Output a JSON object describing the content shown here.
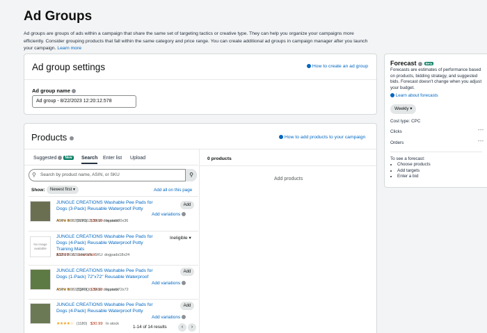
{
  "page": {
    "title": "Ad Groups",
    "intro": "Ad groups are groups of ads within a campaign that share the same set of targeting tactics or creative type. They can help you organize your campaigns more efficiently. Consider grouping products that fall within the same category and price range. You can create additional ad groups in campaign manager after you launch your campaign.",
    "learn_more": "Learn more"
  },
  "settings": {
    "heading": "Ad group settings",
    "help_link": "How to create an ad group",
    "name_label": "Ad group name",
    "name_value": "Ad group - 8/22/2023 12:20:12.578"
  },
  "products": {
    "heading": "Products",
    "help_link": "How to add products to your campaign",
    "tabs": [
      {
        "label": "Suggested",
        "badge": "New"
      },
      {
        "label": "Search"
      },
      {
        "label": "Enter list"
      },
      {
        "label": "Upload"
      }
    ],
    "search_placeholder": "Search by product name, ASIN, or SKU",
    "show_label": "Show:",
    "sort_value": "Newest first",
    "add_all": "Add all on this page",
    "items": [
      {
        "title": "JUNGLE CREATIONS Washable Pee Pads for Dogs (3-Pack) Reusable Waterproof Potty",
        "reviews": "(1180)",
        "price": "$36.99",
        "stock": "In stock",
        "asin": "ASIN: B0825NYG12",
        "sku": "SKU: dogpads30x36",
        "action": "Add",
        "variations": "Add variations"
      },
      {
        "title": "JUNGLE CREATIONS Washable Pee Pads for Dogs (4-Pack) Reusable Waterproof Potty Training Mats",
        "price": "$32.99",
        "stock": "Low stock",
        "asin": "ASIN: B082EHHKVN",
        "sku": "SKU: dogpads18x24",
        "action": "Ineligible",
        "thumb_text": "No image available"
      },
      {
        "title": "JUNGLE CREATIONS Washable Pee Pads for Dogs (1-Pack) 72\"x72\" Reusable Waterproof",
        "reviews": "(1180)",
        "price": "$39.99",
        "stock": "In stock",
        "asin": "ASIN: B082ZQF9QL",
        "sku": "SKU: dogpads72x72",
        "action": "Add",
        "variations": "Add variations"
      },
      {
        "title": "JUNGLE CREATIONS Washable Pee Pads for Dogs (4-Pack) Reusable Waterproof Potty",
        "reviews": "(1180)",
        "price": "$30.99",
        "stock": "In stock",
        "action": "Add",
        "variations": "Add variations"
      }
    ],
    "pagination": "1-14 of 14 results",
    "right_count": "0 products",
    "right_empty": "Add products"
  },
  "forecast": {
    "title": "Forecast",
    "badge": "Beta",
    "desc": "Forecasts are estimates of performance based on products, bidding strategy, and suggested bids. Forecast doesn't change when you adjust your budget.",
    "learn_link": "Learn about forecasts",
    "period": "Weekly",
    "cost_type": "Cost type: CPC",
    "clicks_label": "Clicks",
    "orders_label": "Orders",
    "metric_placeholder": "---",
    "cta_title": "To see a forecast:",
    "steps": [
      "Choose products",
      "Add targets",
      "Enter a bid"
    ]
  },
  "colors": {
    "link": "#0066c0",
    "price": "#b12704",
    "star": "#f0a21e",
    "badge": "#067d62",
    "page_bg": "#f3f4f5"
  }
}
